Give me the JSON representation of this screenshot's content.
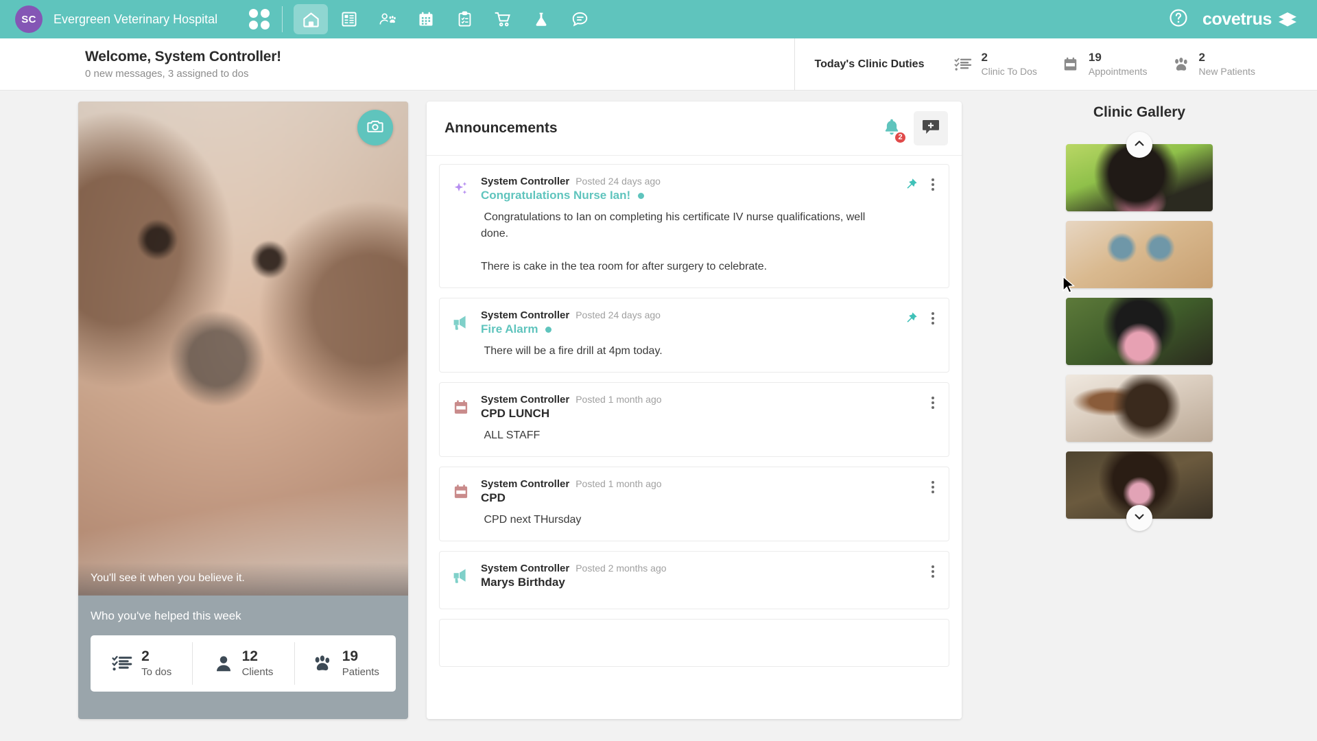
{
  "topnav": {
    "avatar_initials": "SC",
    "clinic_name": "Evergreen Veterinary Hospital",
    "apps_icon": "grid-dots-icon",
    "brand": "covetrus",
    "help_icon": "help-circle-icon",
    "accent_color": "#5fc4bd",
    "avatar_color": "#8456b5",
    "items": [
      {
        "name": "home",
        "icon": "home-icon",
        "active": true
      },
      {
        "name": "records",
        "icon": "document-list-icon",
        "active": false
      },
      {
        "name": "clients-patients",
        "icon": "person-paw-icon",
        "active": false
      },
      {
        "name": "appointments",
        "icon": "calendar-icon",
        "active": false
      },
      {
        "name": "to-dos",
        "icon": "clipboard-check-icon",
        "active": false
      },
      {
        "name": "shop",
        "icon": "shopping-cart-icon",
        "active": false
      },
      {
        "name": "lab",
        "icon": "flask-icon",
        "active": false
      },
      {
        "name": "messages",
        "icon": "chat-bubble-icon",
        "active": false
      }
    ]
  },
  "welcome": {
    "title": "Welcome, System Controller!",
    "subtitle": "0 new messages, 3 assigned to dos"
  },
  "duties": {
    "label": "Today's Clinic Duties",
    "items": [
      {
        "value": "2",
        "label": "Clinic To Dos",
        "icon": "checklist-icon"
      },
      {
        "value": "19",
        "label": "Appointments",
        "icon": "calendar-icon"
      },
      {
        "value": "2",
        "label": "New Patients",
        "icon": "paw-icon"
      }
    ]
  },
  "hero": {
    "camera_icon": "camera-icon",
    "quote": "You'll see it when you believe it.",
    "stats_title": "Who you've helped this week",
    "stats": [
      {
        "value": "2",
        "label": "To dos",
        "icon": "checklist-icon"
      },
      {
        "value": "12",
        "label": "Clients",
        "icon": "person-icon"
      },
      {
        "value": "19",
        "label": "Patients",
        "icon": "paw-icon"
      }
    ]
  },
  "announcements": {
    "title": "Announcements",
    "bell_icon": "bell-icon",
    "bell_badge": "2",
    "add_icon": "add-announcement-icon",
    "items": [
      {
        "icon": "sparkle-icon",
        "author": "System Controller",
        "time": "Posted 24 days ago",
        "subject": "Congratulations Nurse Ian!",
        "subject_style": "teal",
        "has_dot": true,
        "pinned": true,
        "text": " Congratulations to Ian on completing his certificate IV nurse qualifications, well done.\n\nThere is cake in the tea room for after surgery to celebrate."
      },
      {
        "icon": "megaphone-icon",
        "author": "System Controller",
        "time": "Posted 24 days ago",
        "subject": "Fire Alarm",
        "subject_style": "teal",
        "has_dot": true,
        "pinned": true,
        "text": " There will be a fire drill at 4pm today."
      },
      {
        "icon": "calendar-red-icon",
        "author": "System Controller",
        "time": "Posted 1 month ago",
        "subject": "CPD LUNCH",
        "subject_style": "dark",
        "has_dot": false,
        "pinned": false,
        "text": " ALL STAFF"
      },
      {
        "icon": "calendar-red-icon",
        "author": "System Controller",
        "time": "Posted 1 month ago",
        "subject": "CPD",
        "subject_style": "dark",
        "has_dot": false,
        "pinned": false,
        "text": " CPD next THursday"
      },
      {
        "icon": "megaphone-icon",
        "author": "System Controller",
        "time": "Posted 2 months ago",
        "subject": "Marys Birthday",
        "subject_style": "dark",
        "has_dot": false,
        "pinned": false,
        "text": ""
      }
    ]
  },
  "gallery": {
    "title": "Clinic Gallery",
    "scroll_up_icon": "chevron-up-icon",
    "scroll_down_icon": "chevron-down-icon",
    "thumbs": [
      {
        "name": "rottweiler-photo"
      },
      {
        "name": "ginger-cat-photo"
      },
      {
        "name": "border-collie-photo"
      },
      {
        "name": "jack-russell-photo"
      },
      {
        "name": "cocker-spaniel-photo"
      }
    ]
  }
}
